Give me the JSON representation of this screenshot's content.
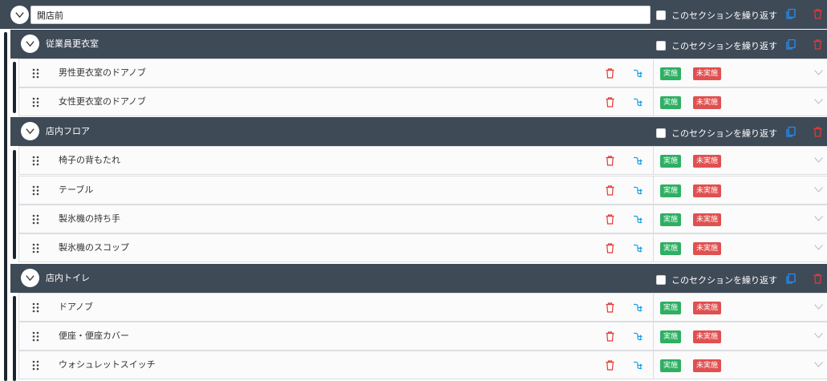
{
  "checklist": {
    "title_value": "開店前",
    "repeat_label": "このセクションを繰り返す",
    "sections": [
      {
        "title": "従業員更衣室",
        "items": [
          {
            "label": "男性更衣室のドアノブ",
            "done_label": "実施",
            "undone_label": "未実施"
          },
          {
            "label": "女性更衣室のドアノブ",
            "done_label": "実施",
            "undone_label": "未実施"
          }
        ]
      },
      {
        "title": "店内フロア",
        "items": [
          {
            "label": "椅子の背もたれ",
            "done_label": "実施",
            "undone_label": "未実施"
          },
          {
            "label": "テーブル",
            "done_label": "実施",
            "undone_label": "未実施"
          },
          {
            "label": "製氷機の持ち手",
            "done_label": "実施",
            "undone_label": "未実施"
          },
          {
            "label": "製氷機のスコップ",
            "done_label": "実施",
            "undone_label": "未実施"
          }
        ]
      },
      {
        "title": "店内トイレ",
        "items": [
          {
            "label": "ドアノブ",
            "done_label": "実施",
            "undone_label": "未実施"
          },
          {
            "label": "便座・便座カバー",
            "done_label": "実施",
            "undone_label": "未実施"
          },
          {
            "label": "ウォシュレットスイッチ",
            "done_label": "実施",
            "undone_label": "未実施"
          }
        ]
      }
    ]
  },
  "icons": {
    "collapse": "chevron-down-icon",
    "copy": "copy-icon",
    "delete": "trash-icon",
    "drag": "drag-handle-icon",
    "branch": "branch-icon",
    "expand_row": "chevron-down-icon"
  },
  "colors": {
    "header_bg": "#3f4a57",
    "rail": "#1c2530",
    "copy_icon": "#1e90ff",
    "delete_icon": "#e53935",
    "done_badge": "#2eaf62",
    "undone_badge": "#e05050",
    "branch_icon": "#1aa3e8"
  }
}
